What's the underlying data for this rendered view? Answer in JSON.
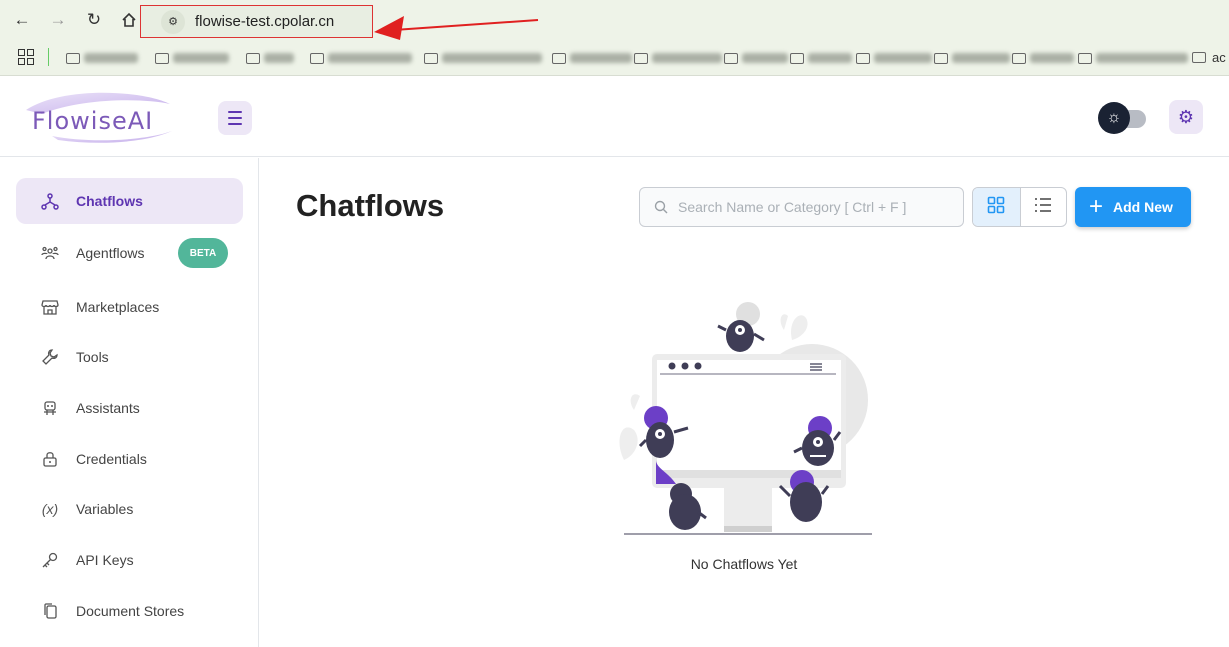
{
  "browser": {
    "url": "flowise-test.cpolar.cn",
    "bookmark_last": "ac"
  },
  "header": {
    "logo_text": "FlowiseAI"
  },
  "sidebar": {
    "items": [
      {
        "label": "Chatflows"
      },
      {
        "label": "Agentflows",
        "badge": "BETA"
      },
      {
        "label": "Marketplaces"
      },
      {
        "label": "Tools"
      },
      {
        "label": "Assistants"
      },
      {
        "label": "Credentials"
      },
      {
        "label": "Variables"
      },
      {
        "label": "API Keys"
      },
      {
        "label": "Document Stores"
      }
    ]
  },
  "main": {
    "title": "Chatflows",
    "search_placeholder": "Search Name or Category [ Ctrl + F ]",
    "add_button": "Add New",
    "empty_text": "No Chatflows Yet"
  },
  "colors": {
    "accent": "#5e35b1",
    "primary_button": "#2196f3",
    "beta_badge": "#52b69a"
  }
}
